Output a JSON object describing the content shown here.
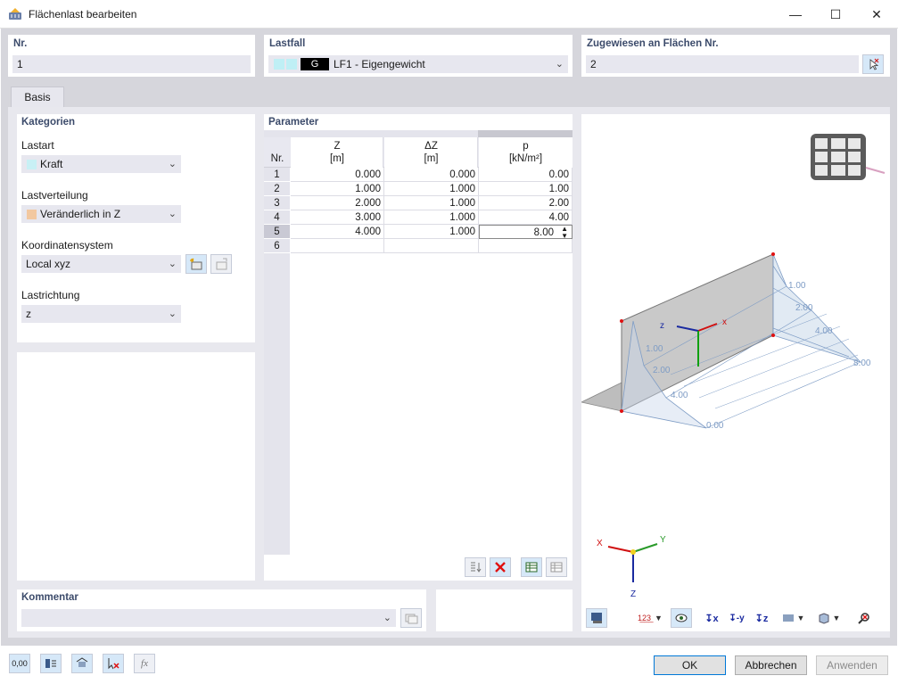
{
  "window": {
    "title": "Flächenlast bearbeiten"
  },
  "nr": {
    "label": "Nr.",
    "value": "1"
  },
  "lastfall": {
    "label": "Lastfall",
    "code": "G",
    "value": "LF1 - Eigengewicht"
  },
  "zugewiesen": {
    "label": "Zugewiesen an Flächen Nr.",
    "value": "2"
  },
  "tabs": [
    {
      "label": "Basis"
    }
  ],
  "kategorien": {
    "title": "Kategorien",
    "lastart": {
      "label": "Lastart",
      "value": "Kraft",
      "color": "#c8f0f5"
    },
    "lastverteilung": {
      "label": "Lastverteilung",
      "value": "Veränderlich in Z",
      "color": "#f2c8a0"
    },
    "koordinatensystem": {
      "label": "Koordinatensystem",
      "value": "Local xyz"
    },
    "lastrichtung": {
      "label": "Lastrichtung",
      "value": "z"
    }
  },
  "parameter": {
    "title": "Parameter",
    "columns": [
      {
        "name": "Z",
        "unit": "[m]"
      },
      {
        "name": "ΔZ",
        "unit": "[m]"
      },
      {
        "name": "p",
        "unit": "[kN/m²]"
      }
    ],
    "nr_header": "Nr.",
    "rows": [
      {
        "nr": "1",
        "z": "0.000",
        "dz": "0.000",
        "p": "0.00"
      },
      {
        "nr": "2",
        "z": "1.000",
        "dz": "1.000",
        "p": "1.00"
      },
      {
        "nr": "3",
        "z": "2.000",
        "dz": "1.000",
        "p": "2.00"
      },
      {
        "nr": "4",
        "z": "3.000",
        "dz": "1.000",
        "p": "4.00"
      },
      {
        "nr": "5",
        "z": "4.000",
        "dz": "1.000",
        "p": "8.00"
      },
      {
        "nr": "6",
        "z": "",
        "dz": "",
        "p": ""
      }
    ]
  },
  "kommentar": {
    "label": "Kommentar",
    "value": ""
  },
  "viewport": {
    "load_labels": [
      "1.00",
      "2.00",
      "4.00",
      "8.00",
      "1.00",
      "2.00",
      "4.00",
      "8.00",
      "0.00"
    ],
    "axis_local": {
      "z": "z",
      "x": "x"
    },
    "axis_global": {
      "x": "X",
      "y": "Y",
      "z": "Z"
    }
  },
  "buttons": {
    "ok": "OK",
    "cancel": "Abbrechen",
    "apply": "Anwenden"
  },
  "bottom_icons": [
    "units-icon",
    "section-icon",
    "display-icon",
    "clear-icon",
    "function-icon"
  ]
}
